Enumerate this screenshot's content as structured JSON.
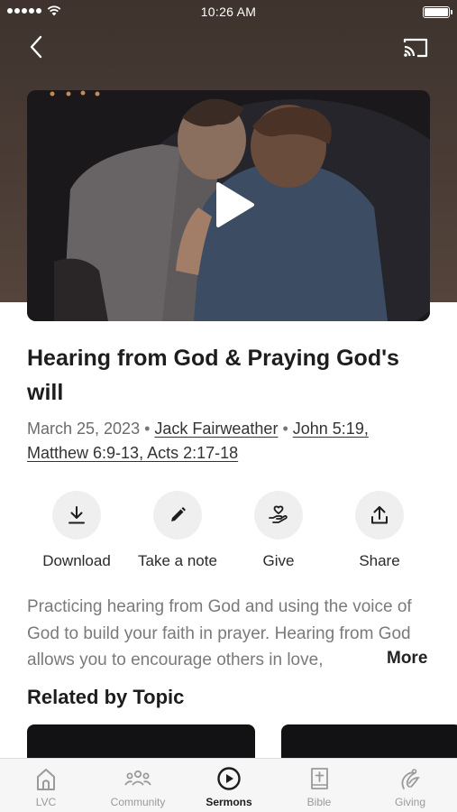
{
  "status_bar": {
    "time": "10:26 AM"
  },
  "nav": {
    "back_icon": "chevron-left-icon",
    "cast_icon": "cast-icon"
  },
  "video": {
    "play_icon": "play-icon"
  },
  "sermon": {
    "title": "Hearing from God & Praying God's will",
    "date": "March 25, 2023",
    "speaker": "Jack Fairweather",
    "scripture_line1": "John 5:19,",
    "scripture_line2": "Matthew 6:9-13, Acts 2:17-18",
    "description": "Practicing hearing from God and using the voice of God to build your faith in prayer.  Hearing from God allows you to encourage others in love,",
    "more_label": "More"
  },
  "actions": [
    {
      "label": "Download",
      "icon": "download-icon"
    },
    {
      "label": "Take a note",
      "icon": "pencil-icon"
    },
    {
      "label": "Give",
      "icon": "give-heart-hand-icon"
    },
    {
      "label": "Share",
      "icon": "share-icon"
    }
  ],
  "related": {
    "title": "Related by Topic"
  },
  "tabs": [
    {
      "label": "LVC",
      "icon": "church-icon",
      "active": false
    },
    {
      "label": "Community",
      "icon": "people-icon",
      "active": false
    },
    {
      "label": "Sermons",
      "icon": "play-circle-icon",
      "active": true
    },
    {
      "label": "Bible",
      "icon": "bible-icon",
      "active": false
    },
    {
      "label": "Giving",
      "icon": "giving-icon",
      "active": false
    }
  ],
  "colors": {
    "hero": "#4a3c35",
    "tab_active": "#1d1d1d",
    "tab_inactive": "#9a9a9a"
  }
}
